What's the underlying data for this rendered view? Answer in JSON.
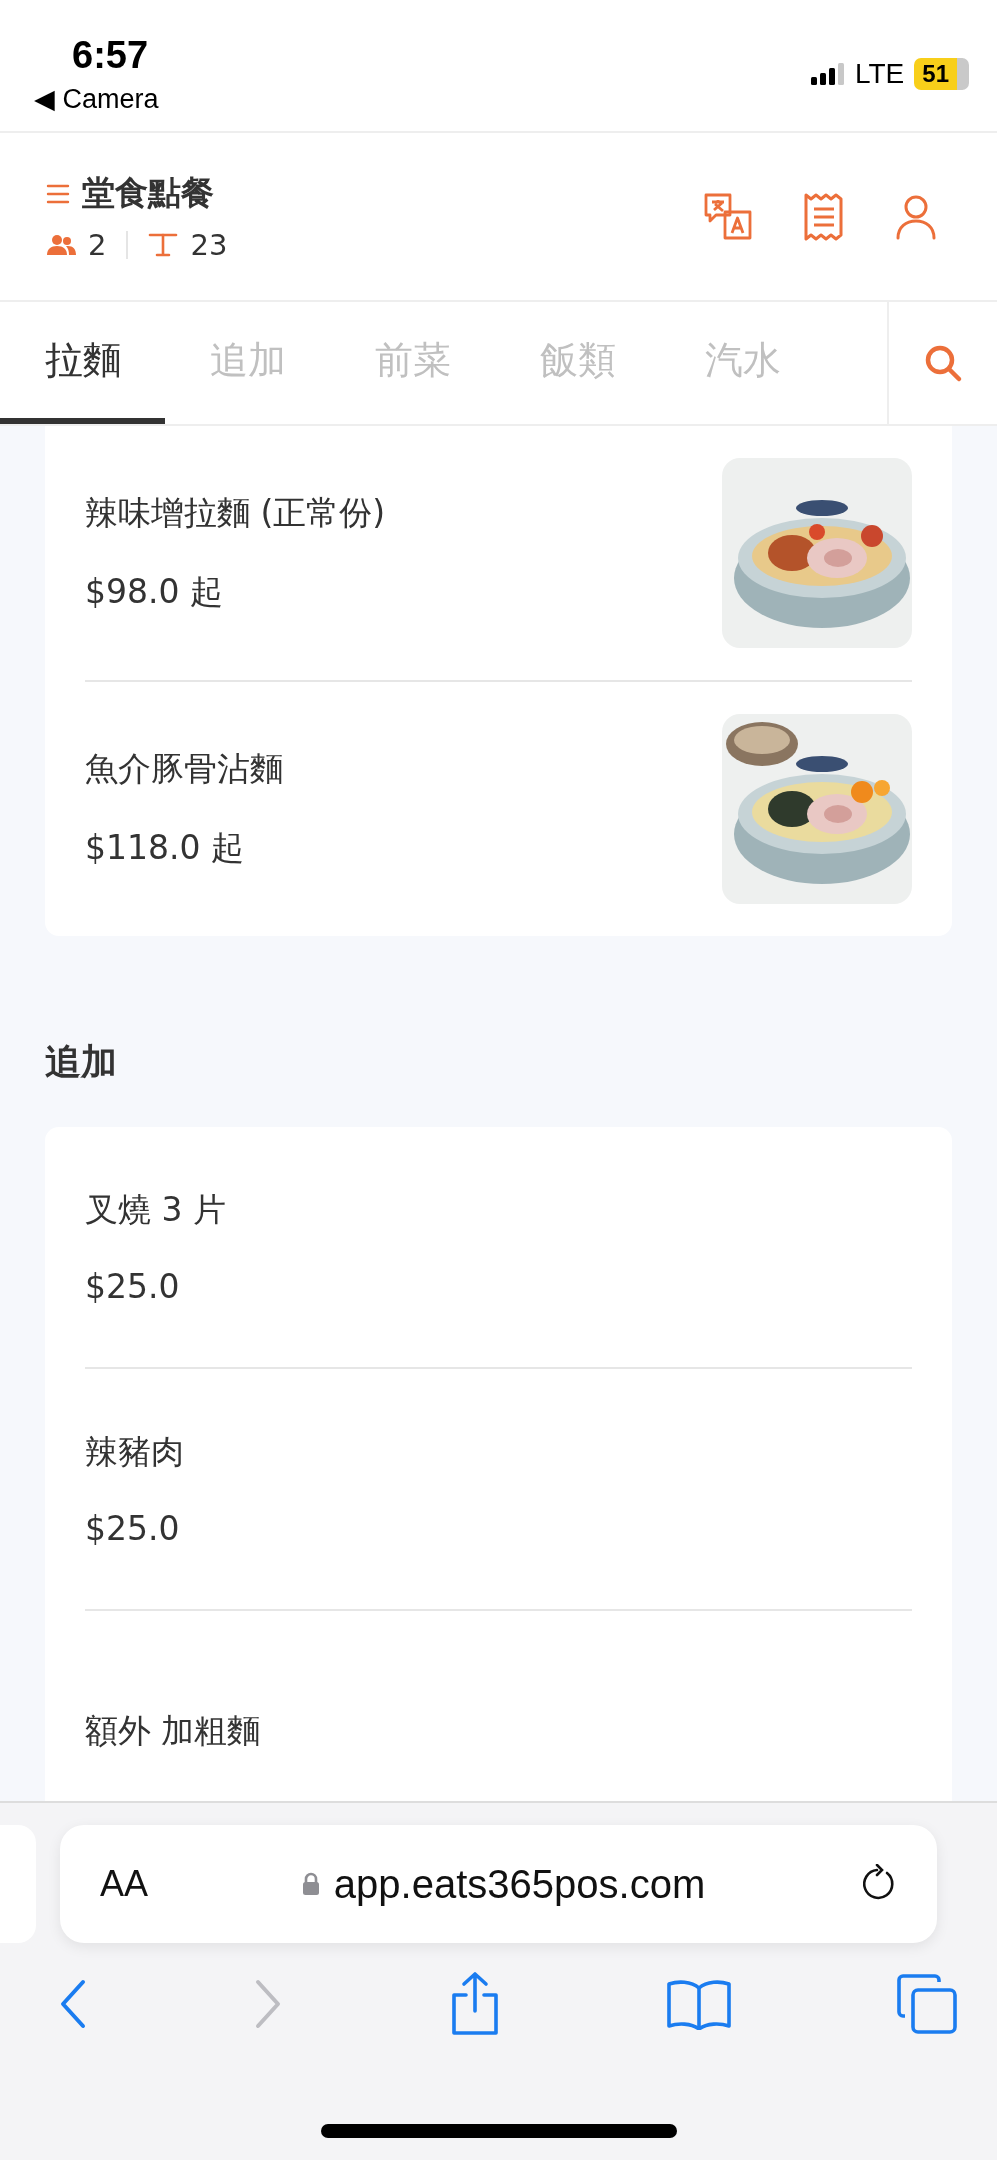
{
  "status_bar": {
    "time": "6:57",
    "back_label": "◀ Camera",
    "network": "LTE",
    "battery": "51"
  },
  "header": {
    "title": "堂食點餐",
    "guests": "2",
    "table": "23"
  },
  "tabs": [
    {
      "label": "拉麵",
      "selected": true
    },
    {
      "label": "追加",
      "selected": false
    },
    {
      "label": "前菜",
      "selected": false
    },
    {
      "label": "飯類",
      "selected": false
    },
    {
      "label": "汽水",
      "selected": false
    }
  ],
  "sections": [
    {
      "items": [
        {
          "name": "辣味增拉麵 (正常份)",
          "price": "$98.0 起",
          "kind": "picture"
        },
        {
          "name": "魚介豚骨沾麵",
          "price": "$118.0 起",
          "kind": "picture"
        }
      ]
    },
    {
      "heading": "追加",
      "items": [
        {
          "name": "叉燒 3 片",
          "price": "$25.0"
        },
        {
          "name": "辣豬肉",
          "price": "$25.0"
        },
        {
          "name": "額外 加粗麵"
        }
      ]
    }
  ],
  "browser": {
    "text_size": "AA",
    "url": "app.eats365pos.com"
  }
}
